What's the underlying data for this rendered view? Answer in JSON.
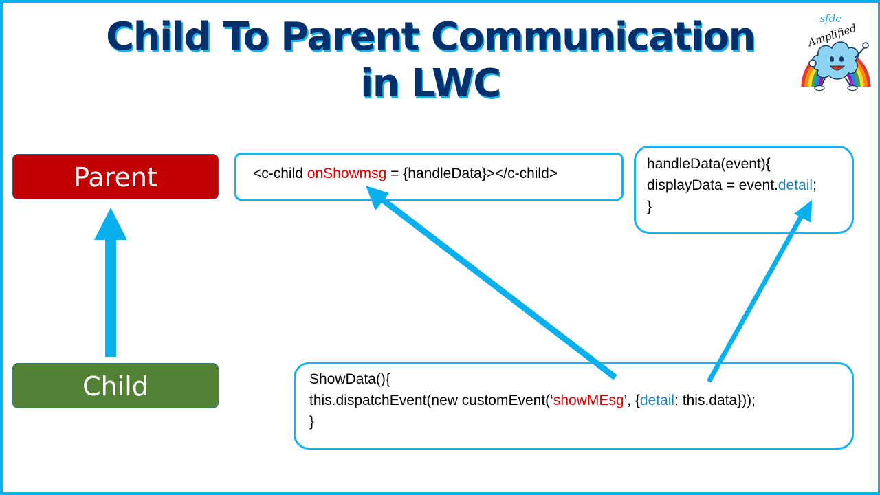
{
  "title": {
    "line1": "Child To Parent Communication",
    "line2": "in LWC"
  },
  "logo": {
    "text_top": "sfdc",
    "text_bottom": "Amplified",
    "icon": "rainbow-cloud-mascot-logo"
  },
  "colors": {
    "frame": "#0ab0ee",
    "title": "#05306e",
    "title_shadow": "#1cb0ea",
    "parent_fill": "#c00000",
    "child_fill": "#538135",
    "arrow": "#0ab0ee",
    "highlight_red": "#e00000",
    "highlight_blue": "#1e82c0"
  },
  "nodes": {
    "parent": {
      "label": "Parent"
    },
    "child": {
      "label": "Child"
    }
  },
  "code": {
    "template": {
      "prefix": "<c-child ",
      "event_attr": "onShowmsg",
      "suffix": " = {handleData}></c-child>"
    },
    "handler": {
      "line1": "handleData(event){",
      "line2_prefix": "displayData = event.",
      "line2_key": "detail",
      "line2_suffix": ";",
      "line3": "}"
    },
    "dispatch": {
      "line1": "ShowData(){",
      "line2_prefix": "this.dispatchEvent(new customEvent(‘",
      "line2_event": "showMEsg",
      "line2_mid": "’, {",
      "line2_key": "detail",
      "line2_suffix": ": this.data}));",
      "line3": "}"
    }
  },
  "connections": [
    {
      "from": "child",
      "to": "parent",
      "meaning": "child-to-parent flow"
    },
    {
      "from": "dispatch.event_name",
      "to": "template.event_attr",
      "meaning": "event name maps to on-handler attribute"
    },
    {
      "from": "dispatch.detail",
      "to": "handler.detail",
      "meaning": "detail payload received by handler"
    }
  ]
}
